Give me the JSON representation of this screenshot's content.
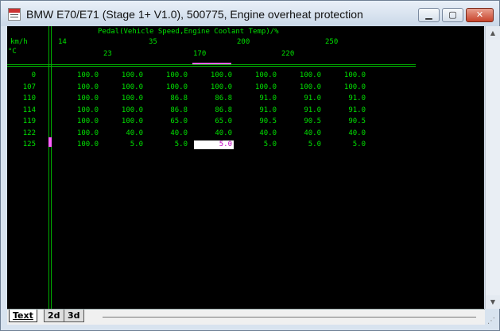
{
  "window": {
    "title": "BMW E70/E71 (Stage 1+ V1.0), 500775, Engine overheat protection"
  },
  "table": {
    "header_title": "Pedal(Vehicle Speed,Engine Coolant Temp)/%",
    "row_axis_unit": "km/h",
    "col_axis_unit": "°C",
    "speed_headers": [
      "14",
      "35",
      "200",
      "250"
    ],
    "temp_headers": [
      "23",
      "170",
      "220"
    ],
    "row_labels": [
      "0",
      "107",
      "110",
      "114",
      "119",
      "122",
      "125"
    ],
    "rows": [
      [
        "100.0",
        "100.0",
        "100.0",
        "100.0",
        "100.0",
        "100.0",
        "100.0"
      ],
      [
        "100.0",
        "100.0",
        "100.0",
        "100.0",
        "100.0",
        "100.0",
        "100.0"
      ],
      [
        "100.0",
        "100.0",
        "86.8",
        "86.8",
        "91.0",
        "91.0",
        "91.0"
      ],
      [
        "100.0",
        "100.0",
        "86.8",
        "86.8",
        "91.0",
        "91.0",
        "91.0"
      ],
      [
        "100.0",
        "100.0",
        "65.0",
        "65.0",
        "90.5",
        "90.5",
        "90.5"
      ],
      [
        "100.0",
        "40.0",
        "40.0",
        "40.0",
        "40.0",
        "40.0",
        "40.0"
      ],
      [
        "100.0",
        "5.0",
        "5.0",
        "5.0",
        "5.0",
        "5.0",
        "5.0"
      ]
    ],
    "selected_cell": {
      "row": 6,
      "col": 3
    }
  },
  "tabs": [
    "Text",
    "2d",
    "3d"
  ],
  "colors": {
    "grid_text": "#00e000",
    "selection_text": "#c000c0",
    "background": "#000000"
  }
}
